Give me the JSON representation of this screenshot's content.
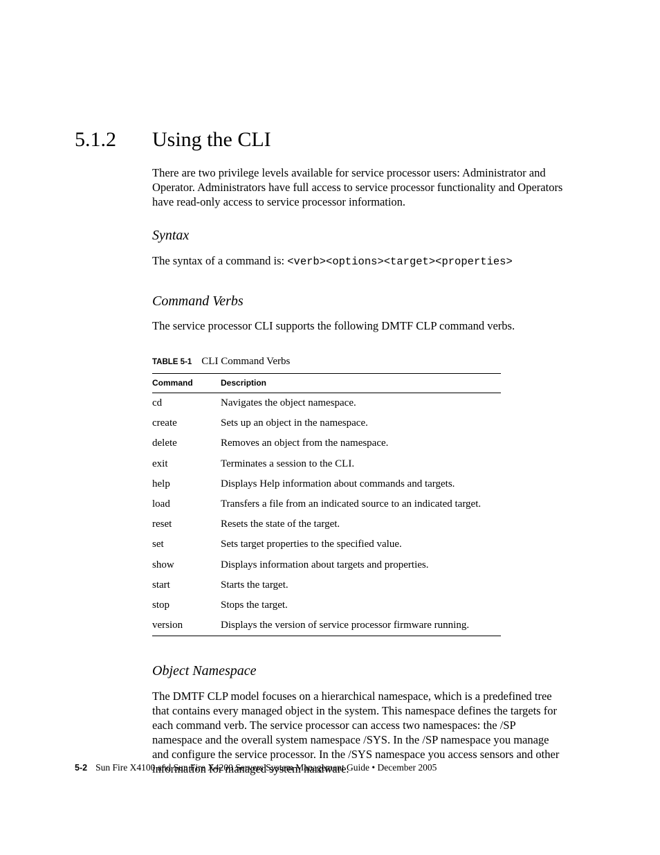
{
  "section": {
    "number": "5.1.2",
    "title": "Using the CLI"
  },
  "intro": "There are two privilege levels available for service processor users: Administrator and Operator. Administrators have full access to service processor functionality and Operators have read-only access to service processor information.",
  "syntax": {
    "heading": "Syntax",
    "lead": "The syntax of a command is:  ",
    "code": "<verb><options><target><properties>"
  },
  "verbs": {
    "heading": "Command Verbs",
    "intro": "The service processor CLI supports the following DMTF CLP command verbs.",
    "table_label": "TABLE 5-1",
    "table_title": "CLI Command Verbs",
    "columns": {
      "cmd": "Command",
      "desc": "Description"
    },
    "rows": [
      {
        "cmd": "cd",
        "desc": "Navigates the object namespace."
      },
      {
        "cmd": "create",
        "desc": "Sets up an object in the namespace."
      },
      {
        "cmd": "delete",
        "desc": "Removes an object from the namespace."
      },
      {
        "cmd": "exit",
        "desc": "Terminates a session to the CLI."
      },
      {
        "cmd": "help",
        "desc": "Displays Help information about commands and targets."
      },
      {
        "cmd": "load",
        "desc": "Transfers a file from an indicated source to an indicated target."
      },
      {
        "cmd": "reset",
        "desc": "Resets the state of the target."
      },
      {
        "cmd": "set",
        "desc": "Sets target properties to the specified value."
      },
      {
        "cmd": "show",
        "desc": "Displays information about targets and properties."
      },
      {
        "cmd": "start",
        "desc": "Starts the target."
      },
      {
        "cmd": "stop",
        "desc": "Stops the target."
      },
      {
        "cmd": "version",
        "desc": "Displays the version of service processor firmware running."
      }
    ]
  },
  "namespace": {
    "heading": "Object Namespace",
    "body": "The DMTF CLP model focuses on a hierarchical namespace, which is a predefined tree that contains every managed object in the system. This namespace defines the targets for each command verb. The service processor can access two namespaces: the /SP namespace and the overall system namespace /SYS. In the /SP namespace you manage and configure the service processor. In the /SYS namespace you access sensors and other information for managed system hardware."
  },
  "footer": {
    "page": "5-2",
    "text": "Sun Fire X4100 and Sun Fire X4200 Servers System Management Guide • December 2005"
  }
}
